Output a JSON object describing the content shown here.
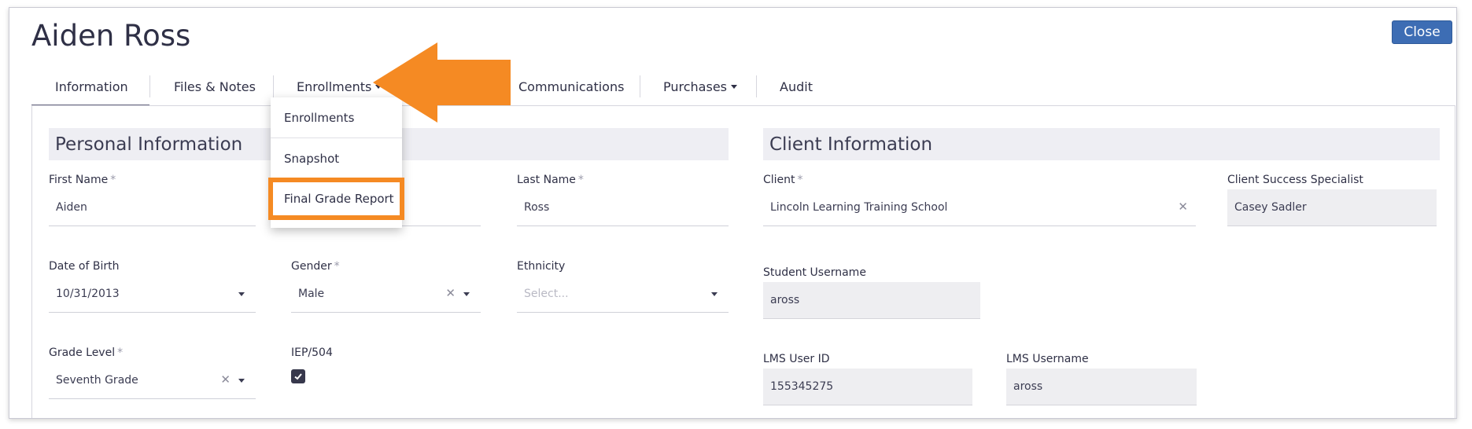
{
  "header": {
    "title": "Aiden Ross",
    "close_label": "Close"
  },
  "tabs": [
    {
      "label": "Information"
    },
    {
      "label": "Files & Notes"
    },
    {
      "label": "Enrollments"
    },
    {
      "label": "Communications"
    },
    {
      "label": "Purchases"
    },
    {
      "label": "Audit"
    }
  ],
  "enrollments_menu": [
    "Enrollments",
    "Snapshot",
    "Final Grade Report"
  ],
  "personal": {
    "title": "Personal Information",
    "first_name": {
      "label": "First Name",
      "value": "Aiden"
    },
    "last_name": {
      "label": "Last Name",
      "value": "Ross"
    },
    "dob": {
      "label": "Date of Birth",
      "value": "10/31/2013"
    },
    "gender": {
      "label": "Gender",
      "value": "Male"
    },
    "ethnicity": {
      "label": "Ethnicity",
      "placeholder": "Select..."
    },
    "grade": {
      "label": "Grade Level",
      "value": "Seventh Grade"
    },
    "iep": {
      "label": "IEP/504",
      "checked": true
    }
  },
  "client": {
    "title": "Client Information",
    "client": {
      "label": "Client",
      "value": "Lincoln Learning Training School"
    },
    "specialist": {
      "label": "Client Success Specialist",
      "value": "Casey Sadler"
    },
    "student_username": {
      "label": "Student Username",
      "value": "aross"
    },
    "lms_user_id": {
      "label": "LMS User ID",
      "value": "155345275"
    },
    "lms_username": {
      "label": "LMS Username",
      "value": "aross"
    }
  },
  "required_mark": "*",
  "colors": {
    "accent": "#3d6db4",
    "callout": "#f58a23",
    "section_bg": "#eeeef3"
  },
  "icons": [
    "caret-down-icon",
    "clear-x-icon",
    "check-icon",
    "arrow-left-icon"
  ]
}
